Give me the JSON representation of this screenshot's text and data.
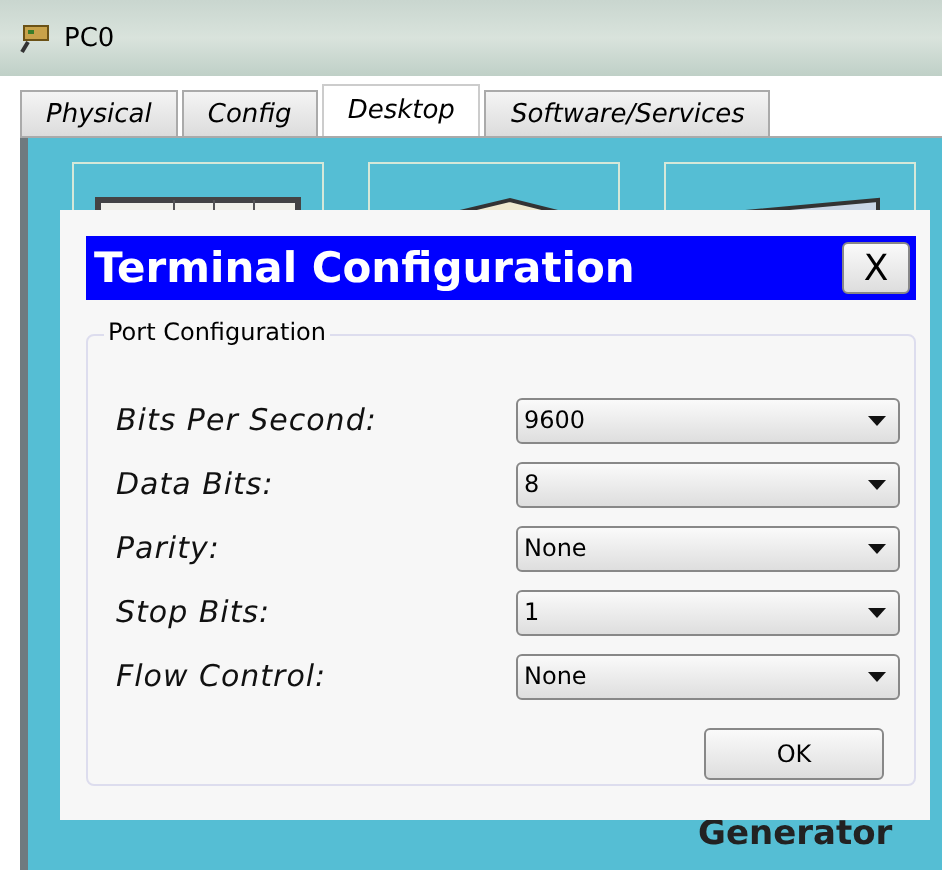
{
  "window": {
    "title": "PC0"
  },
  "tabs": [
    {
      "label": "Physical",
      "selected": false
    },
    {
      "label": "Config",
      "selected": false
    },
    {
      "label": "Desktop",
      "selected": true
    },
    {
      "label": "Software/Services",
      "selected": false
    }
  ],
  "desktop": {
    "partial_label": "Generator"
  },
  "dialog": {
    "title": "Terminal Configuration",
    "close": "X",
    "group": "Port Configuration",
    "fields": [
      {
        "label": "Bits Per Second:",
        "value": "9600"
      },
      {
        "label": "Data Bits:",
        "value": "8"
      },
      {
        "label": "Parity:",
        "value": "None"
      },
      {
        "label": "Stop Bits:",
        "value": "1"
      },
      {
        "label": "Flow Control:",
        "value": "None"
      }
    ],
    "ok": "OK"
  }
}
